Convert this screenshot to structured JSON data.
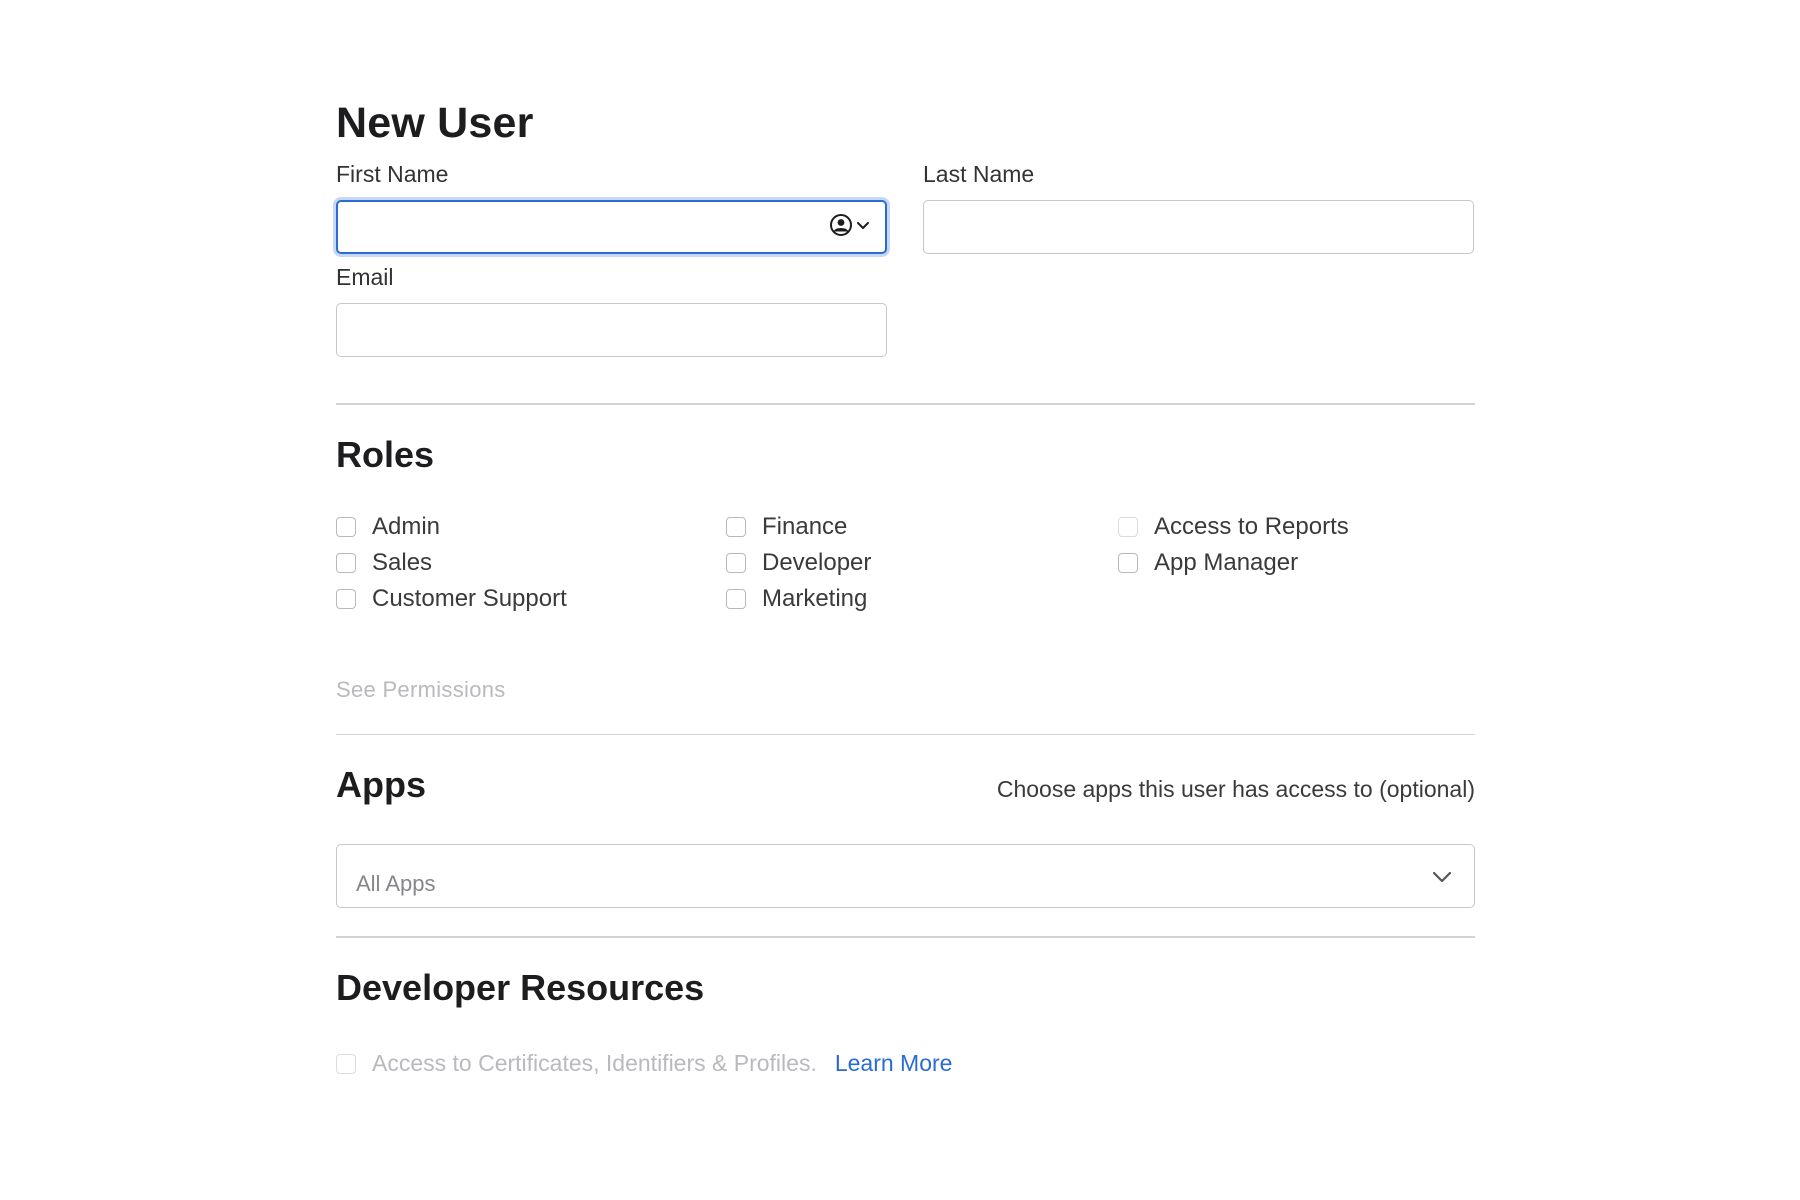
{
  "colors": {
    "accent": "#2b6bd3",
    "text": "#1d1d1f",
    "muted": "#b9b9be",
    "border": "#c7c7cc"
  },
  "form": {
    "title": "New User",
    "first_name": {
      "label": "First Name",
      "value": "",
      "autofill_icon": "contact-card-icon"
    },
    "last_name": {
      "label": "Last Name",
      "value": ""
    },
    "email": {
      "label": "Email",
      "value": ""
    }
  },
  "roles": {
    "title": "Roles",
    "items": [
      {
        "label": "Admin",
        "checked": false
      },
      {
        "label": "Finance",
        "checked": false
      },
      {
        "label": "Access to Reports",
        "checked": false
      },
      {
        "label": "Sales",
        "checked": false
      },
      {
        "label": "Developer",
        "checked": false
      },
      {
        "label": "App Manager",
        "checked": false
      },
      {
        "label": "Customer Support",
        "checked": false
      },
      {
        "label": "Marketing",
        "checked": false
      }
    ],
    "see_permissions": "See Permissions"
  },
  "apps": {
    "title": "Apps",
    "hint": "Choose apps this user has access to (optional)",
    "select_value": "All Apps"
  },
  "developer_resources": {
    "title": "Developer Resources",
    "access_label": "Access to Certificates, Identifiers & Profiles.",
    "learn_more": "Learn More"
  }
}
